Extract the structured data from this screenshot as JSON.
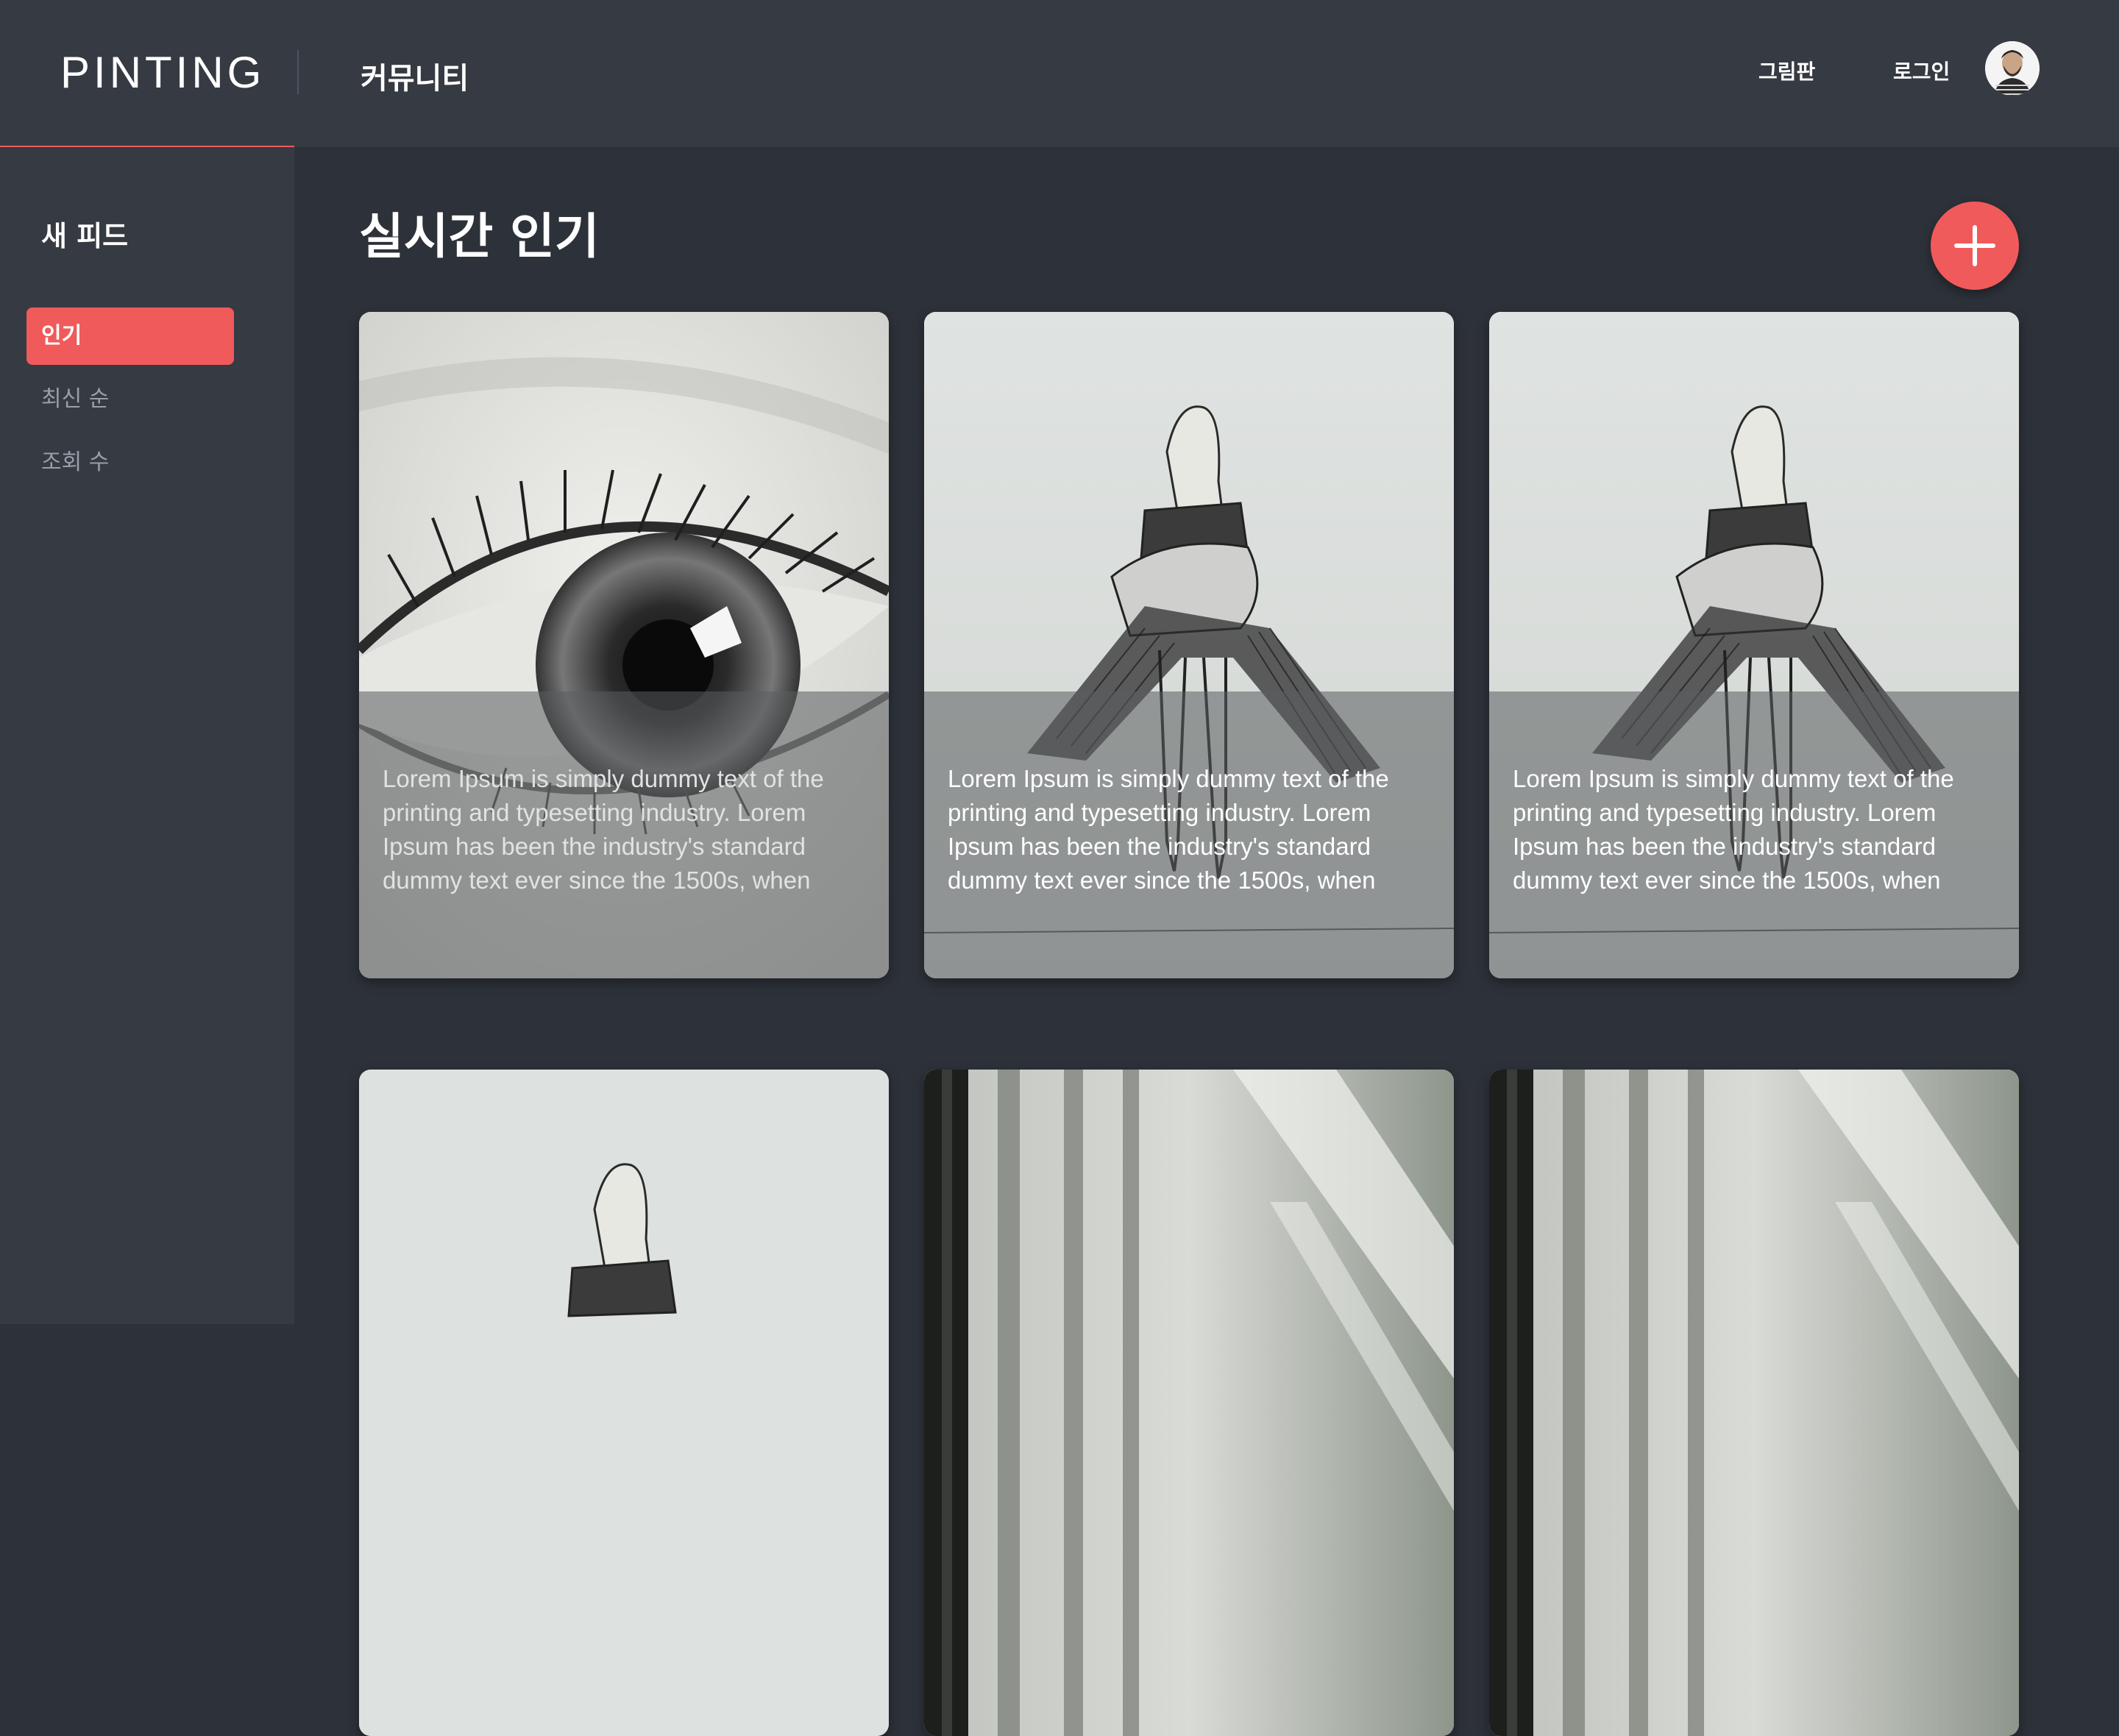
{
  "header": {
    "logo": "PINTING",
    "section_title": "커뮤니티",
    "links": {
      "draw": "그림판",
      "login": "로그인"
    },
    "avatar_icon": "user-avatar"
  },
  "sidebar": {
    "title": "새 피드",
    "items": [
      {
        "label": "인기",
        "active": true
      },
      {
        "label": "최신 순",
        "active": false
      },
      {
        "label": "조회 수",
        "active": false
      }
    ]
  },
  "main": {
    "title": "실시간 인기",
    "add_button_icon": "plus-icon",
    "cards": [
      {
        "image": "eye-sketch",
        "text": "Lorem Ipsum is simply dummy text of the printing and typesetting industry. Lorem Ipsum has been the industry's standard dummy text ever since the 1500s, when"
      },
      {
        "image": "figure-sketch",
        "text": "Lorem Ipsum is simply dummy text of the printing and typesetting industry. Lorem Ipsum has been the industry's standard dummy text ever since the 1500s, when"
      },
      {
        "image": "figure-sketch",
        "text": "Lorem Ipsum is simply dummy text of the printing and typesetting industry. Lorem Ipsum has been the industry's standard dummy text ever since the 1500s, when"
      },
      {
        "image": "figure-sketch",
        "text": ""
      },
      {
        "image": "window-shadow-photo",
        "text": ""
      },
      {
        "image": "window-shadow-photo",
        "text": ""
      }
    ]
  },
  "colors": {
    "accent": "#f05a5b",
    "header_bg": "#363a43",
    "body_bg": "#2d3139",
    "muted_text": "#9a9ea6"
  }
}
